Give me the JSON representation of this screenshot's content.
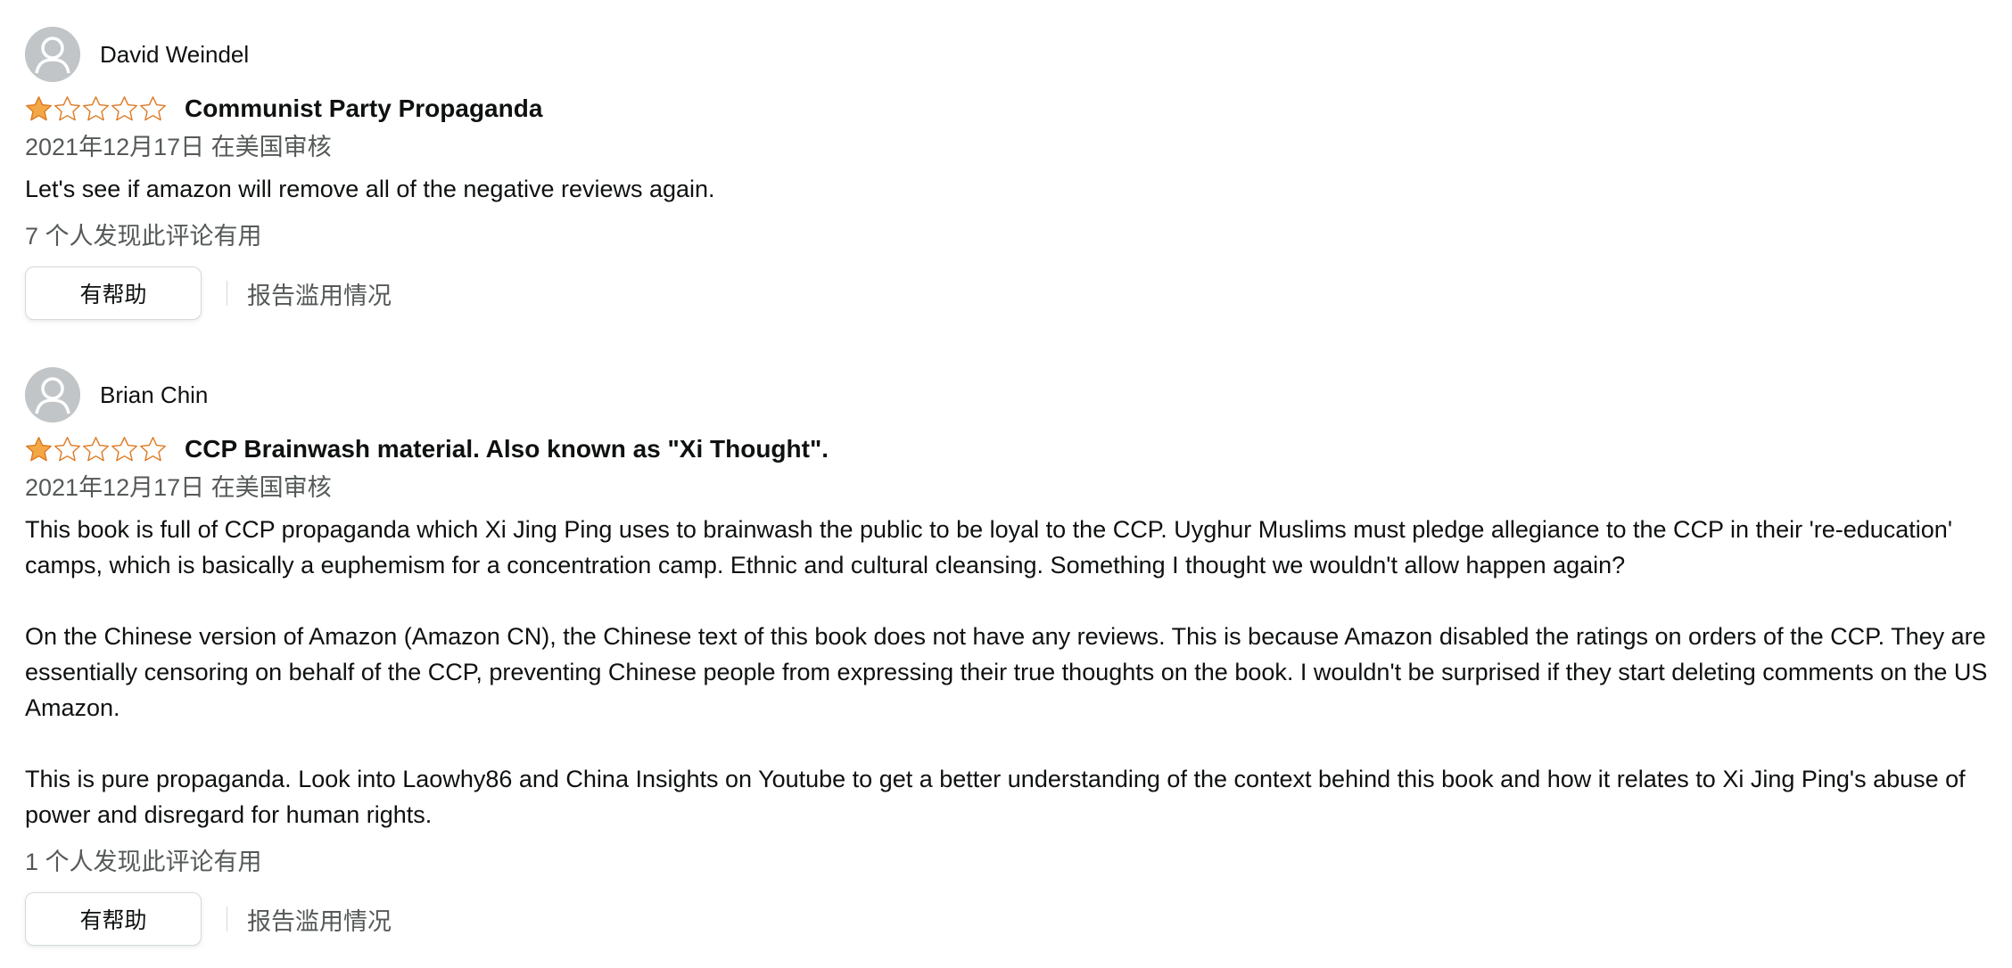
{
  "colors": {
    "star_fill": "#f3a847",
    "star_outline": "#de7921",
    "avatar_bg": "#c1c5c7"
  },
  "reviews": [
    {
      "author": "David Weindel",
      "rating": 1,
      "rating_max": 5,
      "title": "Communist Party Propaganda",
      "date": "2021年12月17日 在美国审核",
      "body": [
        "Let's see if amazon will remove all of the negative reviews again."
      ],
      "helpful_count": "7 个人发现此评论有用",
      "helpful_button": "有帮助",
      "report_link": "报告滥用情况"
    },
    {
      "author": "Brian Chin",
      "rating": 1,
      "rating_max": 5,
      "title": "CCP Brainwash material. Also known as \"Xi Thought\".",
      "date": "2021年12月17日 在美国审核",
      "body": [
        "This book is full of CCP propaganda which Xi Jing Ping uses to brainwash the public to be loyal to the CCP. Uyghur Muslims must pledge allegiance to the CCP in their 're-education' camps, which is basically a euphemism for a concentration camp. Ethnic and cultural cleansing. Something I thought we wouldn't allow happen again?",
        "On the Chinese version of Amazon (Amazon CN), the Chinese text of this book does not have any reviews. This is because Amazon disabled the ratings on orders of the CCP. They are essentially censoring on behalf of the CCP, preventing Chinese people from expressing their true thoughts on the book. I wouldn't be surprised if they start deleting comments on the US Amazon.",
        "This is pure propaganda. Look into Laowhy86 and China Insights on Youtube to get a better understanding of the context behind this book and how it relates to Xi Jing Ping's abuse of power and disregard for human rights."
      ],
      "helpful_count": "1 个人发现此评论有用",
      "helpful_button": "有帮助",
      "report_link": "报告滥用情况"
    }
  ]
}
